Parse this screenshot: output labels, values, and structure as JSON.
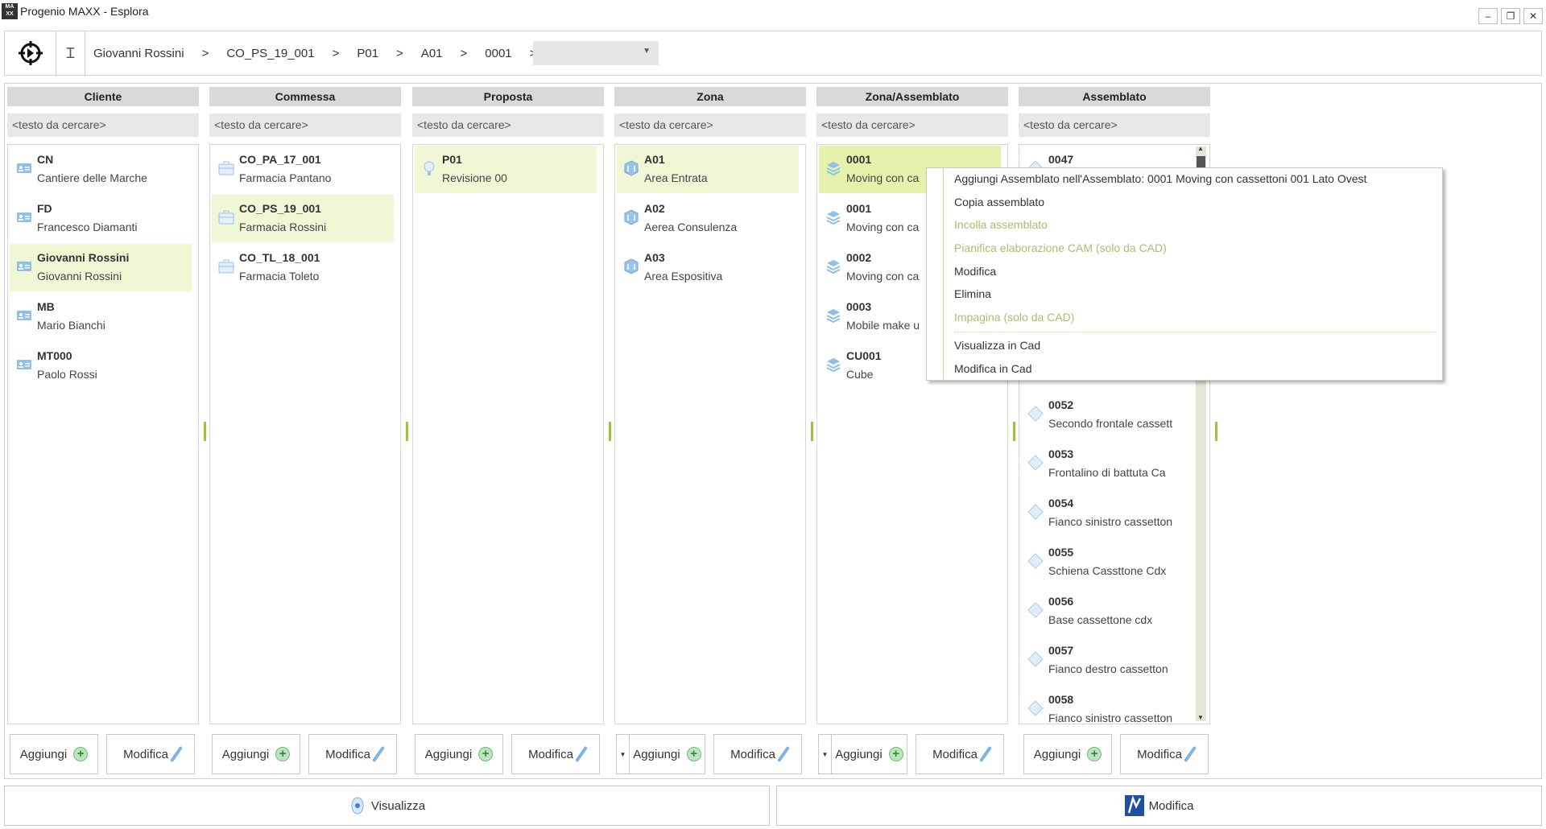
{
  "window": {
    "title": "Progenio MAXX - Esplora",
    "logo_text": "MAXX",
    "controls": [
      "minimize",
      "restore",
      "close"
    ]
  },
  "toolbar": {
    "breadcrumb": [
      "Giovanni Rossini",
      "CO_PS_19_001",
      "P01",
      "A01",
      "0001"
    ],
    "separator": ">",
    "dropdown_value": ""
  },
  "search_placeholder": "<testo da cercare>",
  "columns": [
    {
      "header": "Cliente",
      "icon": "contact-card-icon",
      "items": [
        {
          "code": "CN",
          "desc": "Cantiere delle Marche"
        },
        {
          "code": "FD",
          "desc": "Francesco Diamanti"
        },
        {
          "code": "Giovanni Rossini",
          "desc": "Giovanni Rossini",
          "selected": true
        },
        {
          "code": "MB",
          "desc": "Mario Bianchi"
        },
        {
          "code": "MT000",
          "desc": "Paolo Rossi"
        }
      ]
    },
    {
      "header": "Commessa",
      "icon": "briefcase-icon",
      "items": [
        {
          "code": "CO_PA_17_001",
          "desc": "Farmacia Pantano"
        },
        {
          "code": "CO_PS_19_001",
          "desc": "Farmacia Rossini",
          "selected": true
        },
        {
          "code": "CO_TL_18_001",
          "desc": "Farmacia Toleto"
        }
      ]
    },
    {
      "header": "Proposta",
      "icon": "lightbulb-icon",
      "items": [
        {
          "code": "P01",
          "desc": "Revisione 00",
          "selected": true
        }
      ]
    },
    {
      "header": "Zona",
      "icon": "cube-icon",
      "items": [
        {
          "code": "A01",
          "desc": "Area Entrata",
          "selected": true
        },
        {
          "code": "A02",
          "desc": "Aerea Consulenza"
        },
        {
          "code": "A03",
          "desc": "Area Espositiva"
        }
      ]
    },
    {
      "header": "Zona/Assemblato",
      "icon": "layers-icon",
      "items": [
        {
          "code": "0001",
          "desc": "Moving con ca",
          "selected": true,
          "strong": true
        },
        {
          "code": "0001",
          "desc": "Moving con ca"
        },
        {
          "code": "0002",
          "desc": "Moving con ca"
        },
        {
          "code": "0003",
          "desc": "Mobile make u"
        },
        {
          "code": "CU001",
          "desc": "Cube"
        }
      ]
    },
    {
      "header": "Assemblato",
      "icon": "diamond-icon",
      "items": [
        {
          "code": "0047",
          "desc": ""
        },
        {
          "code": "0052",
          "desc": "Secondo frontale cassett",
          "slot": 5
        },
        {
          "code": "0053",
          "desc": "Frontalino di battuta Ca",
          "slot": 6
        },
        {
          "code": "0054",
          "desc": "Fianco sinistro cassetton",
          "slot": 7
        },
        {
          "code": "0055",
          "desc": "Schiena Cassttone Cdx",
          "slot": 8
        },
        {
          "code": "0056",
          "desc": "Base cassettone cdx",
          "slot": 9
        },
        {
          "code": "0057",
          "desc": "Fianco destro cassetton",
          "slot": 10
        },
        {
          "code": "0058",
          "desc": "Fianco sinistro cassetton",
          "slot": 11
        }
      ]
    }
  ],
  "buttons": {
    "add": "Aggiungi",
    "edit": "Modifica"
  },
  "bottom": {
    "view": "Visualizza",
    "edit": "Modifica"
  },
  "context_menu": [
    {
      "label": "Aggiungi Assemblato nell'Assemblato: 0001 Moving con cassettoni 001 Lato Ovest",
      "enabled": true
    },
    {
      "label": "Copia assemblato",
      "enabled": true
    },
    {
      "label": "Incolla assemblato",
      "enabled": false
    },
    {
      "label": "Pianifica elaborazione CAM (solo da CAD)",
      "enabled": false
    },
    {
      "label": "Modifica",
      "enabled": true
    },
    {
      "label": "Elimina",
      "enabled": true
    },
    {
      "label": "Impagina (solo da CAD)",
      "enabled": false
    },
    {
      "label": "Visualizza in Cad",
      "enabled": true
    },
    {
      "label": "Modifica in Cad",
      "enabled": true
    }
  ],
  "colors": {
    "selected": "#eff7d5",
    "selected_strong": "#e6f2ac",
    "disabled_menu": "#a9bf6e",
    "splitter": "#9bc43a"
  }
}
